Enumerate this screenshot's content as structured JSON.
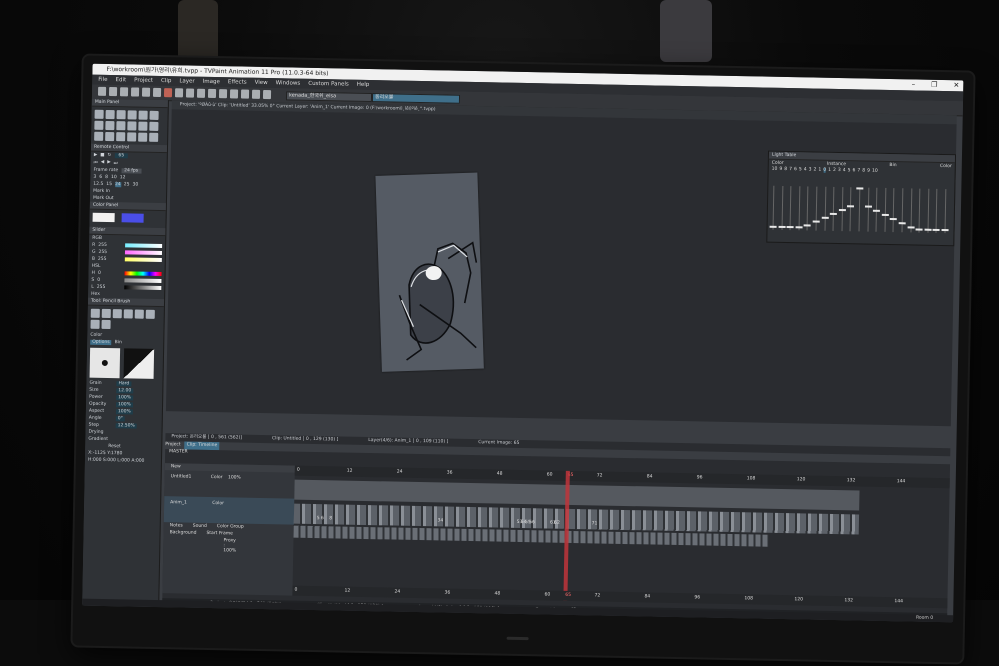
{
  "window": {
    "title": "F:\\workroom\\원가\\영리\\유희.tvpp - TVPaint Animation 11 Pro (11.0.3-64 bits)",
    "controls": [
      "–",
      "❐",
      "✕"
    ]
  },
  "menu": [
    "File",
    "Edit",
    "Project",
    "Clip",
    "Layer",
    "Image",
    "Effects",
    "View",
    "Windows",
    "Custom Panels",
    "Help"
  ],
  "toolbar": {
    "field1": "kenada_한국쉬_elsa",
    "field2": "동리오불"
  },
  "project_info": "Project: 'ºØÀû·ù' Clip: 'Untitled'  33.05%  0°  Current Layer: 'Anim_1'  Current Image: 0 (F:\\workroom\\ì¸íê\\ìºìê¸°.tvpp)",
  "left_panel": {
    "tools_title": "Main Panel",
    "remote_title": "Remote Control",
    "remote_value": "65",
    "framerate_label": "Frame rate",
    "framerate_value": "24 fps",
    "fps_row1": [
      "3",
      "6",
      "8",
      "10",
      "12"
    ],
    "fps_row2": [
      "12.5",
      "15",
      "24",
      "25",
      "30"
    ],
    "mark_in": "Mark In",
    "mark_out": "Mark Out",
    "color_panel": "Color Panel",
    "slider_title": "Slider",
    "rgb_labels": [
      "RGB",
      "R",
      "G",
      "B"
    ],
    "rgb_values": [
      "255",
      "255",
      "255"
    ],
    "hsl_labels": [
      "HSL",
      "H",
      "S",
      "L"
    ],
    "hsl_values": [
      "0",
      "0",
      "255"
    ],
    "hex_label": "Hex",
    "brush_title": "Tool: Pencil Brush",
    "brush_color_label": "Color",
    "options_tab": "Options",
    "bin_tab": "Bin",
    "props": [
      {
        "k": "Grain",
        "v": "Hard"
      },
      {
        "k": "Size",
        "v": "12.00"
      },
      {
        "k": "Power",
        "v": "100%"
      },
      {
        "k": "Opacity",
        "v": "100%"
      },
      {
        "k": "Aspect",
        "v": "100%"
      },
      {
        "k": "Angle",
        "v": "0°"
      },
      {
        "k": "Step",
        "v": "12.50%"
      },
      {
        "k": "Drying",
        "v": ""
      },
      {
        "k": "Gradient",
        "v": ""
      }
    ],
    "reset": "Reset",
    "coords": "X:-1125 Y:1780",
    "hdr": "H:000 S:000 L:000 A:000"
  },
  "light_table": {
    "title": "Light Table",
    "headers": [
      "Color",
      "Instance",
      "Bin",
      "Color"
    ],
    "numbers": [
      "10",
      "9",
      "8",
      "7",
      "6",
      "5",
      "4",
      "3",
      "2",
      "1",
      "0",
      "1",
      "2",
      "3",
      "4",
      "5",
      "6",
      "7",
      "8",
      "9",
      "10"
    ]
  },
  "status_bar": {
    "project": "Project: 온리오불 [ 0 , 561 (562)]",
    "clip": "Clip: Untitled [ 0 , 129 (130) ]",
    "layer": "Layer(4/6): Anim_1 [ 0 , 109 (110) ]",
    "image": "Current Image: 65"
  },
  "timeline": {
    "tabs": [
      "Project",
      "Clip: Timeline"
    ],
    "master": "MASTER",
    "new": "New",
    "layer1": "Untitled1",
    "layer2": "Anim_1",
    "color_label": "Color",
    "opacity": "100%",
    "notes": "Notes",
    "sound": "Sound",
    "color_group": "Color Group",
    "background": "Background",
    "start_frame": "Start Frame",
    "proxy": "Proxy : 100%",
    "ruler": [
      "0",
      "12",
      "24",
      "36",
      "48",
      "60",
      "65",
      "72",
      "84",
      "96",
      "108",
      "120",
      "132",
      "144"
    ],
    "marks": [
      "5",
      "6",
      "8",
      "34",
      "53",
      "54",
      "55",
      "56",
      "61",
      "62",
      "71"
    ]
  },
  "taskbar": {
    "room": "Room 0"
  }
}
